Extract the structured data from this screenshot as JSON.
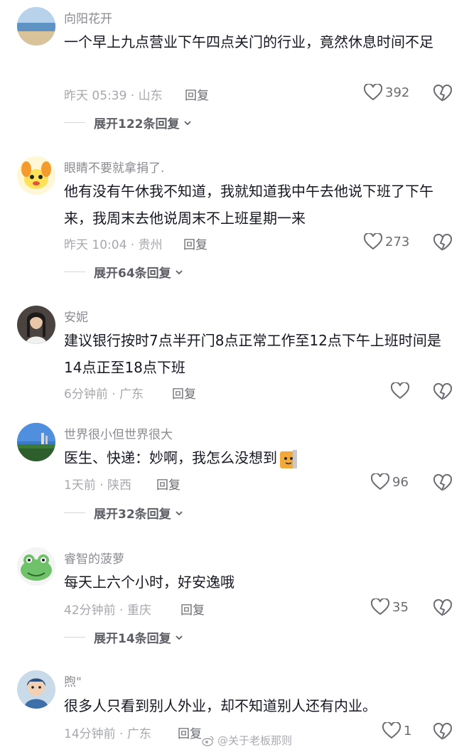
{
  "comments": [
    {
      "username": "向阳花开",
      "text": "一个早上九点营业下午四点关门的行业，竟然休息时间不足",
      "time_location": "昨天 05:39 · 山东",
      "reply_label": "回复",
      "likes": "392",
      "expand_label": "展开122条回复"
    },
    {
      "username": "眼睛不要就拿捐了.",
      "text": "他有没有午休我不知道，我就知道我中午去他说下班了下午来，我周末去他说周末不上班星期一来",
      "time_location": "昨天 10:04 · 贵州",
      "reply_label": "回复",
      "likes": "273",
      "expand_label": "展开64条回复"
    },
    {
      "username": "安妮",
      "text": "建议银行按时7点半开门8点正常工作至12点下午上班时间是14点正至18点下班",
      "time_location": "6分钟前 · 广东",
      "reply_label": "回复",
      "likes": ""
    },
    {
      "username": "世界很小但世界很大",
      "text": "医生、快递：妙啊，我怎么没想到",
      "time_location": "1天前 · 陕西",
      "reply_label": "回复",
      "likes": "96",
      "expand_label": "展开32条回复"
    },
    {
      "username": "睿智的菠萝",
      "text": "每天上六个小时，好安逸哦",
      "time_location": "42分钟前 · 重庆",
      "reply_label": "回复",
      "likes": "35",
      "expand_label": "展开14条回复"
    },
    {
      "username": "煦\"",
      "text": "很多人只看到别人外业，却不知道别人还有内业。",
      "time_location": "14分钟前 · 广东",
      "reply_label": "回复",
      "likes": "1"
    }
  ],
  "icons": {
    "like": "heart-outline-icon",
    "dislike": "broken-heart-icon",
    "expand": "chevron-down-icon"
  },
  "watermark": "@关于老板那则",
  "colors": {
    "text": "#161823",
    "muted": "#a7a8ad",
    "username": "#8a8b91"
  }
}
